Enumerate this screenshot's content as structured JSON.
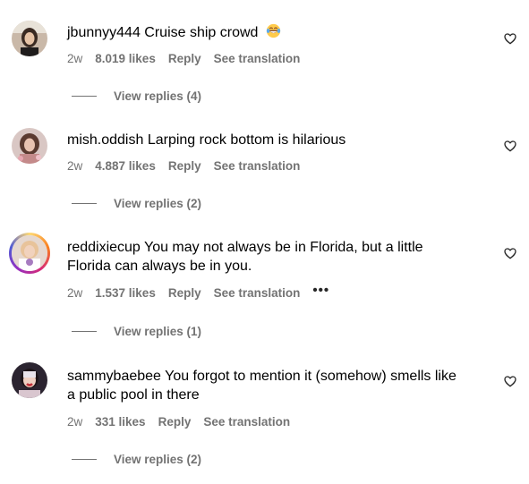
{
  "comments": [
    {
      "username": "jbunnyy444",
      "text": "Cruise ship crowd",
      "emoji": "face-with-tears-of-joy",
      "age": "2w",
      "likes": "8.019 likes",
      "reply": "Reply",
      "translate": "See translation",
      "view_replies": "View replies (4)",
      "has_story_ring": false,
      "has_more_menu": false
    },
    {
      "username": "mish.oddish",
      "text": "Larping rock bottom is hilarious",
      "age": "2w",
      "likes": "4.887 likes",
      "reply": "Reply",
      "translate": "See translation",
      "view_replies": "View replies (2)",
      "has_story_ring": false,
      "has_more_menu": false
    },
    {
      "username": "reddixiecup",
      "text_line1": "You may not always be in Florida, but a little",
      "text_line2": "Florida can always be in you.",
      "age": "2w",
      "likes": "1.537 likes",
      "reply": "Reply",
      "translate": "See translation",
      "more": "•••",
      "view_replies": "View replies (1)",
      "has_story_ring": true,
      "has_more_menu": true
    },
    {
      "username": "sammybaebee",
      "text_line1": "You forgot to mention it (somehow) smells like",
      "text_line2": "a public pool in there",
      "age": "2w",
      "likes": "331 likes",
      "reply": "Reply",
      "translate": "See translation",
      "view_replies": "View replies (2)",
      "has_story_ring": false,
      "has_more_menu": false
    }
  ],
  "icons": {
    "like": "heart-outline-icon",
    "more": "more-options-icon"
  },
  "colors": {
    "text": "#000000",
    "meta": "#737373",
    "story_ring": [
      "#feda75",
      "#fa7e1e",
      "#d62976",
      "#962fbf",
      "#4f5bd5"
    ]
  }
}
